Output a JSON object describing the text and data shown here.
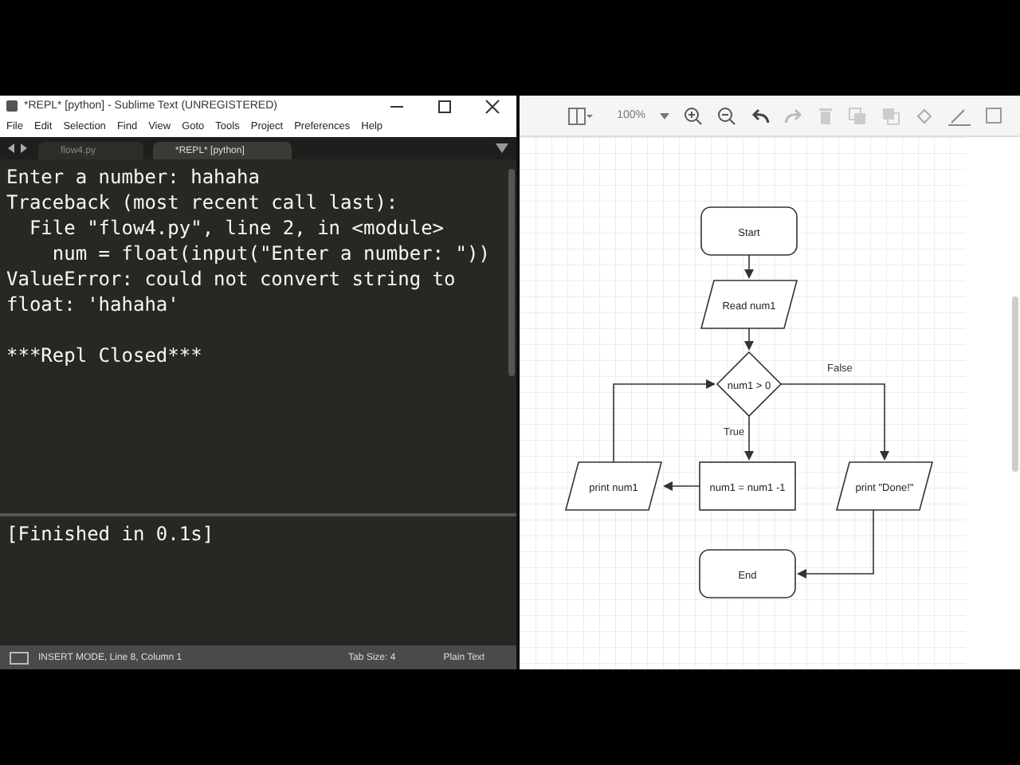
{
  "editor": {
    "window": {
      "title": "*REPL* [python] - Sublime Text (UNREGISTERED)"
    },
    "menu": [
      "File",
      "Edit",
      "Selection",
      "Find",
      "View",
      "Goto",
      "Tools",
      "Project",
      "Preferences",
      "Help"
    ],
    "tabs": [
      {
        "label": "flow4.py",
        "selected": false
      },
      {
        "label": "*REPL* [python]",
        "selected": true
      }
    ],
    "output": [
      "Enter a number: hahaha",
      "Traceback (most recent call last):",
      "  File \"flow4.py\", line 2, in <module>",
      "    num = float(input(\"Enter a number: \"))",
      "ValueError: could not convert string to",
      "float: 'hahaha'"
    ],
    "repl_status": "***Repl Closed***",
    "build_output": [
      "[Finished in 0.1s]"
    ],
    "status_bar": {
      "position": "INSERT MODE, Line 8, Column 1",
      "tab_size": "Tab Size: 4",
      "syntax": "Plain Text"
    }
  },
  "diagram": {
    "toolbar": {
      "zoom": "100%"
    },
    "nodes": [
      {
        "kind": "terminal",
        "label": "Start"
      },
      {
        "kind": "io",
        "label": "Read num1"
      },
      {
        "kind": "decision",
        "label": "num1 > 0"
      },
      {
        "kind": "io",
        "label": "print num1"
      },
      {
        "kind": "process",
        "label": "num1 = num1 -1"
      },
      {
        "kind": "io",
        "label": "print \"Done!\""
      },
      {
        "kind": "terminal",
        "label": "End"
      }
    ],
    "edge_labels": [
      "False",
      "True"
    ]
  }
}
